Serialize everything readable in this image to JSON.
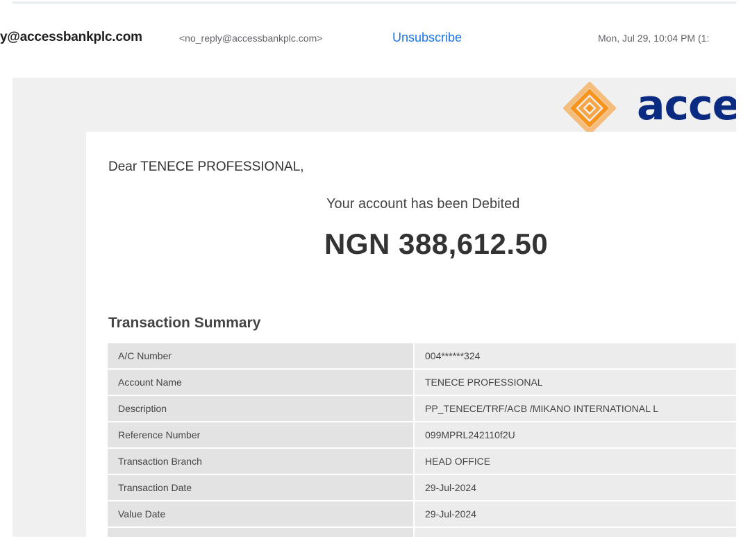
{
  "header": {
    "sender_name": "y@accessbankplc.com",
    "sender_email": "<no_reply@accessbankplc.com>",
    "unsubscribe_label": "Unsubscribe",
    "date": "Mon, Jul 29, 10:04 PM (1:"
  },
  "email": {
    "logo_text": "acces",
    "logo_color": "#f7941d",
    "brand_color": "#0b2b82",
    "greeting": "Dear TENECE PROFESSIONAL,",
    "debit_message": "Your account has been Debited",
    "amount": "NGN 388,612.50",
    "summary_title": "Transaction Summary",
    "summary_rows": [
      {
        "label": "A/C Number",
        "value": "004******324"
      },
      {
        "label": "Account Name",
        "value": "TENECE PROFESSIONAL"
      },
      {
        "label": "Description",
        "value": "PP_TENECE/TRF/ACB /MIKANO INTERNATIONAL L"
      },
      {
        "label": "Reference Number",
        "value": "099MPRL242110f2U"
      },
      {
        "label": "Transaction Branch",
        "value": "HEAD OFFICE"
      },
      {
        "label": "Transaction Date",
        "value": "29-Jul-2024"
      },
      {
        "label": "Value Date",
        "value": "29-Jul-2024"
      },
      {
        "label": "",
        "value": ""
      }
    ]
  }
}
